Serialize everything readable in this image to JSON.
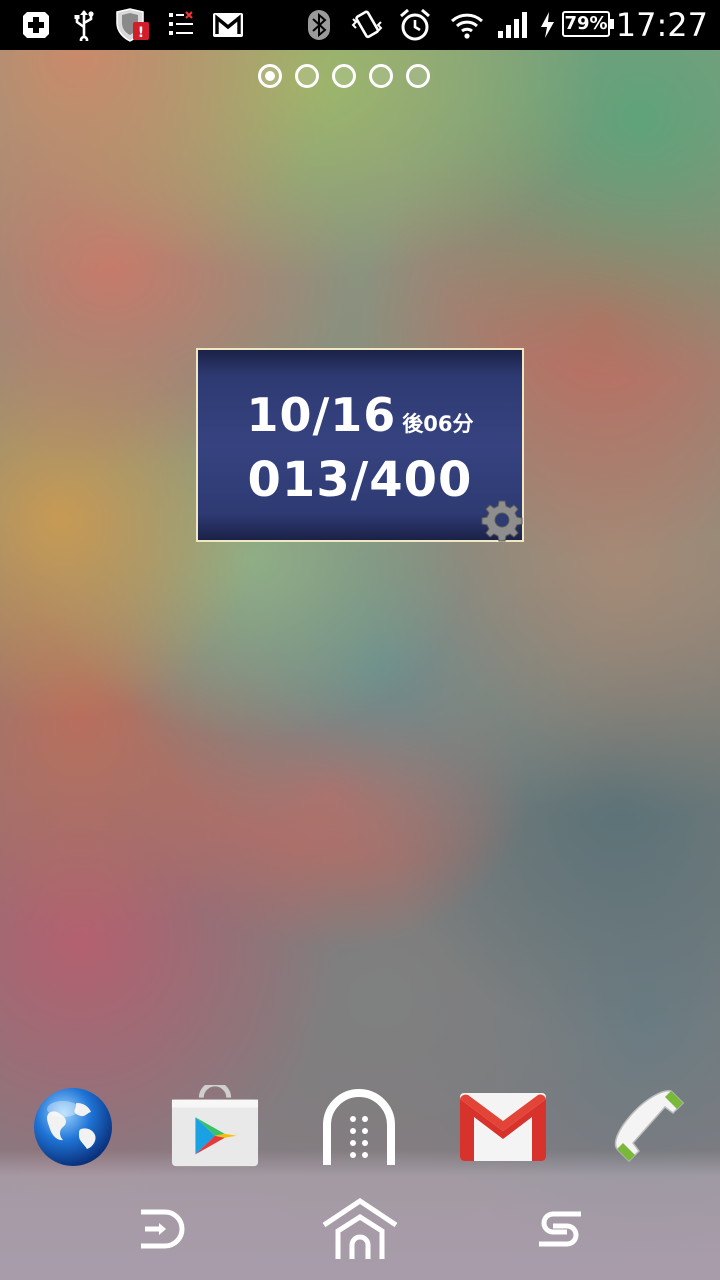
{
  "status_bar": {
    "time": "17:27",
    "battery_percent": "79%",
    "battery_level": 0.79,
    "left_icons": [
      "medical-cross-icon",
      "usb-icon",
      "security-shield-icon",
      "task-list-icon",
      "gmail-notification-icon"
    ],
    "right_icons": [
      "bluetooth-icon",
      "vibrate-icon",
      "alarm-icon",
      "wifi-icon",
      "signal-icon",
      "charging-icon",
      "battery-icon"
    ]
  },
  "home": {
    "page_count": 5,
    "active_page": 0
  },
  "widget": {
    "date": "10/16",
    "date_suffix": "後06分",
    "count": "013/400",
    "settings_icon": "gear-icon"
  },
  "dock": {
    "apps": [
      "browser-globe-icon",
      "play-store-icon",
      "app-drawer-icon",
      "gmail-icon",
      "phone-icon"
    ]
  },
  "nav": {
    "buttons": [
      "back-icon",
      "home-icon",
      "recents-icon"
    ]
  }
}
